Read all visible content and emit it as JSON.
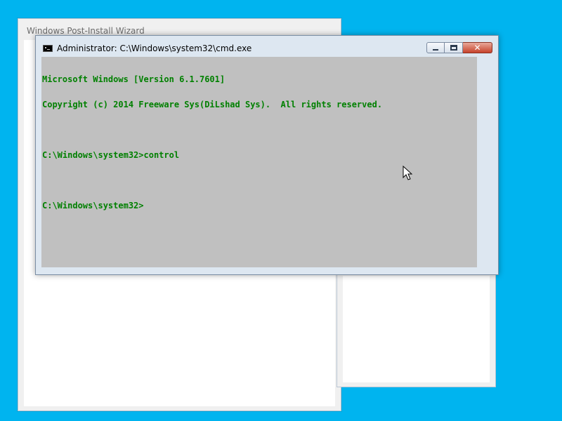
{
  "wizard": {
    "title": "Windows Post-Install Wizard"
  },
  "cmd": {
    "title": "Administrator: C:\\Windows\\system32\\cmd.exe",
    "console_lines": [
      "Microsoft Windows [Version 6.1.7601]",
      "Copyright (c) 2014 Freeware Sys(DiLshad Sys).  All rights reserved.",
      "",
      "C:\\Windows\\system32>control",
      "",
      "C:\\Windows\\system32>"
    ],
    "console_text_color": "#008000",
    "console_bg_color": "#c0c0c0"
  },
  "colors": {
    "desktop": "#00b4ef"
  },
  "icons": {
    "cmd": "cmd-icon",
    "minimize": "minimize-icon",
    "maximize": "maximize-icon",
    "close": "close-icon",
    "cursor": "mouse-pointer-icon"
  }
}
